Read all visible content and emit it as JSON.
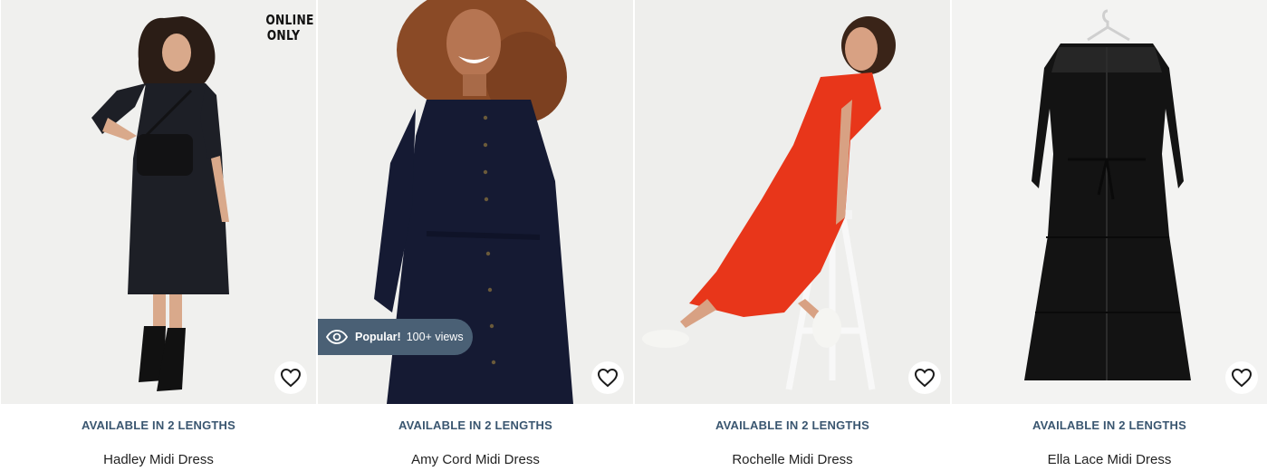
{
  "products": [
    {
      "name": "Hadley Midi Dress",
      "lengths_label": "AVAILABLE IN 2 LENGTHS",
      "badge_line1": "ONLINE",
      "badge_line2": "ONLY",
      "wishlist_icon": "heart-outline-icon"
    },
    {
      "name": "Amy Cord Midi Dress",
      "lengths_label": "AVAILABLE IN 2 LENGTHS",
      "popular_label": "Popular!",
      "popular_views": "100+ views",
      "popular_icon": "eye-icon",
      "wishlist_icon": "heart-outline-icon"
    },
    {
      "name": "Rochelle Midi Dress",
      "lengths_label": "AVAILABLE IN 2 LENGTHS",
      "wishlist_icon": "heart-outline-icon"
    },
    {
      "name": "Ella Lace Midi Dress",
      "lengths_label": "AVAILABLE IN 2 LENGTHS",
      "wishlist_icon": "heart-outline-icon"
    }
  ],
  "colors": {
    "lengths_text": "#3a5670",
    "popular_badge_bg": "#4a6075",
    "name_text": "#222222",
    "photo_bg": "#efefed"
  }
}
